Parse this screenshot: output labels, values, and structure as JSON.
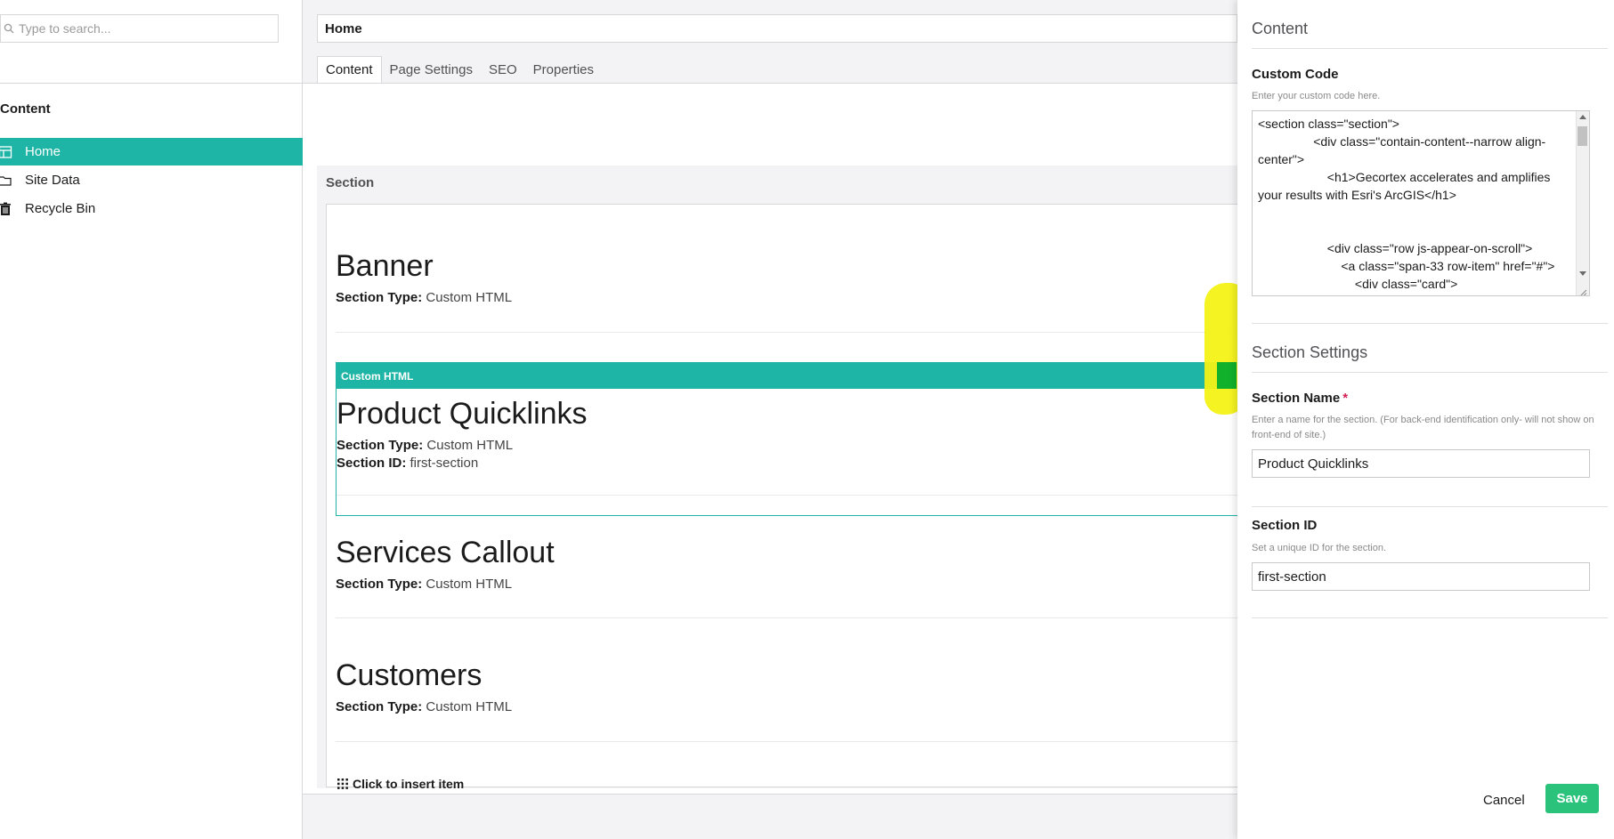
{
  "tree": {
    "search_placeholder": "Type to search...",
    "header": "Content",
    "items": [
      {
        "label": "Home",
        "icon": "content-grid-icon",
        "active": true
      },
      {
        "label": "Site Data",
        "icon": "folder-icon",
        "active": false
      },
      {
        "label": "Recycle Bin",
        "icon": "trash-icon",
        "active": false
      }
    ]
  },
  "editor": {
    "node_name": "Home",
    "tabs": [
      {
        "label": "Content",
        "active": true
      },
      {
        "label": "Page Settings",
        "active": false
      },
      {
        "label": "SEO",
        "active": false
      },
      {
        "label": "Properties",
        "active": false
      }
    ],
    "section_label": "Section",
    "blocks": [
      {
        "title": "Banner",
        "type_label": "Section Type:",
        "type_value": "Custom HTML"
      },
      {
        "title": "Product Quicklinks",
        "type_label": "Section Type:",
        "type_value": "Custom HTML",
        "id_label": "Section ID:",
        "id_value": "first-section",
        "bar_label": "Custom HTML"
      },
      {
        "title": "Services Callout",
        "type_label": "Section Type:",
        "type_value": "Custom HTML"
      },
      {
        "title": "Customers",
        "type_label": "Section Type:",
        "type_value": "Custom HTML"
      }
    ],
    "insert_label": "Click to insert item"
  },
  "overlay": {
    "title": "Content",
    "custom_code": {
      "label": "Custom Code",
      "description": "Enter your custom code here.",
      "value": "<section class=\"section\">\n                <div class=\"contain-content--narrow align-center\">\n                    <h1>Gecortex accelerates and amplifies your results with Esri's ArcGIS</h1>\n\n\n                    <div class=\"row js-appear-on-scroll\">\n                        <a class=\"span-33 row-item\" href=\"#\">\n                            <div class=\"card\">"
    },
    "settings_heading": "Section Settings",
    "section_name": {
      "label": "Section Name",
      "required_mark": "*",
      "description": "Enter a name for the section. (For back-end identification only- will not show on front-end of site.)",
      "value": "Product Quicklinks"
    },
    "section_id": {
      "label": "Section ID",
      "description": "Set a unique ID for the section.",
      "value": "first-section"
    },
    "cancel_label": "Cancel",
    "save_label": "Save"
  },
  "colors": {
    "accent": "#1fb5a6",
    "save": "#2bc37c",
    "highlight": "#f4f215"
  }
}
